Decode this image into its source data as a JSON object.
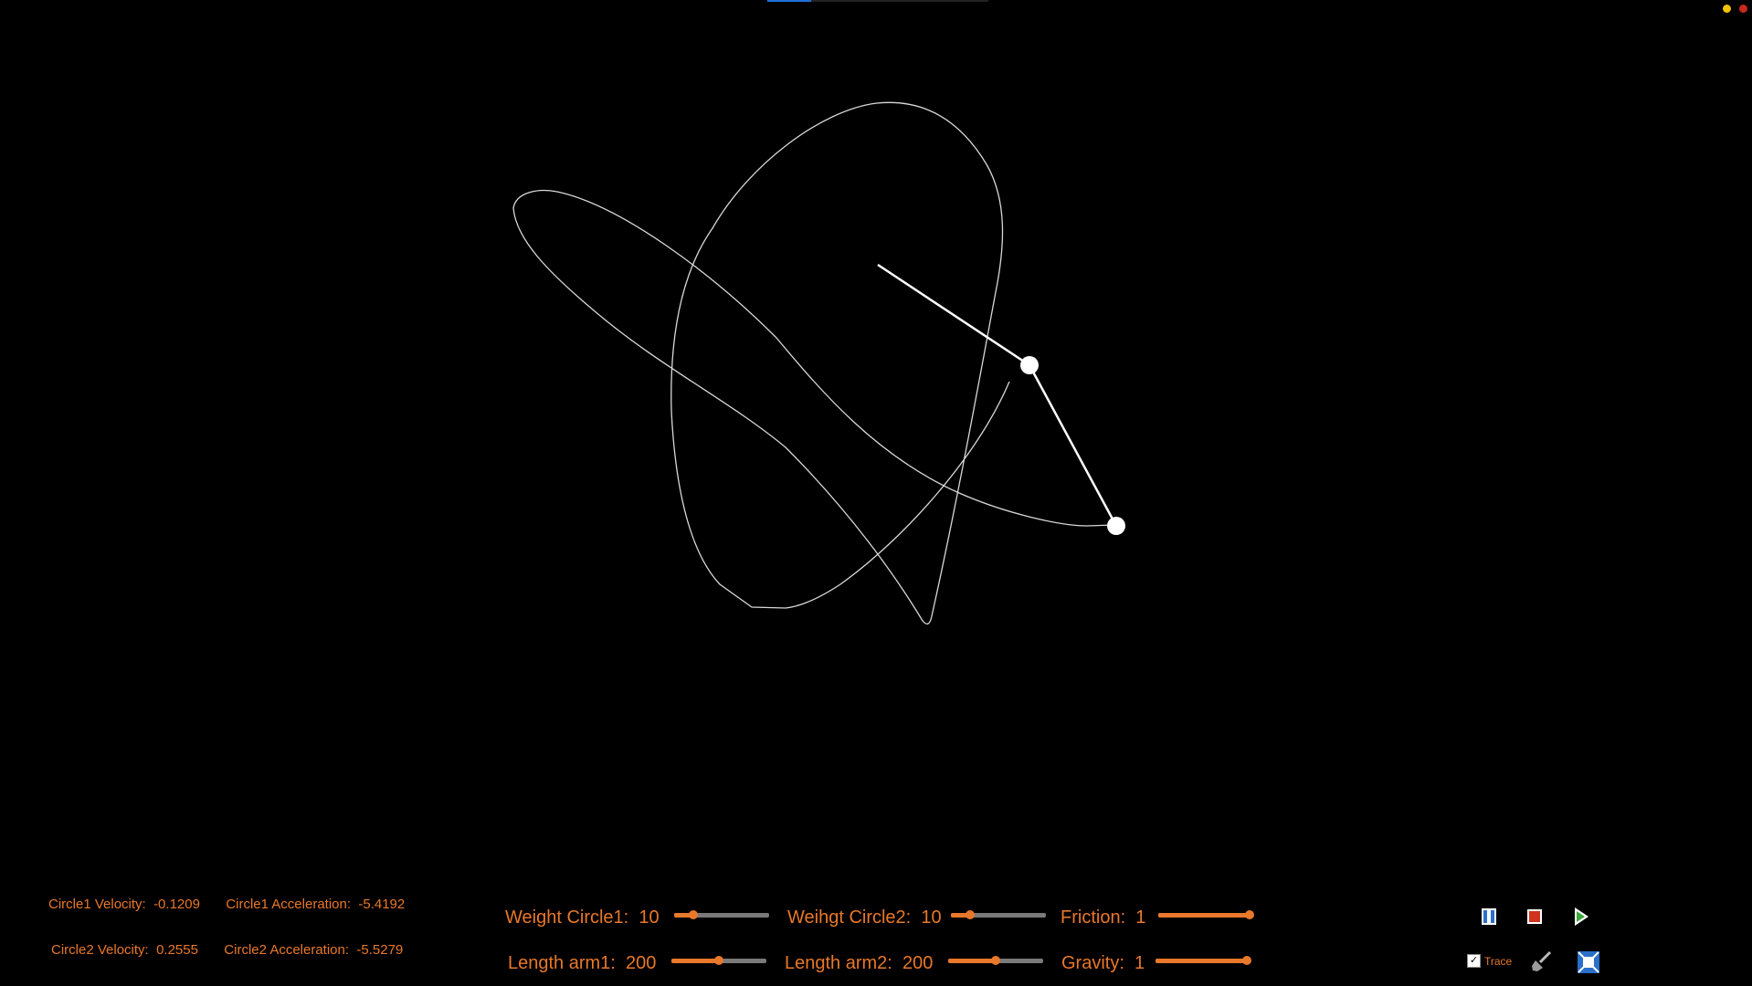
{
  "stats": {
    "c1_vel_label": "Circle1 Velocity:",
    "c1_vel_value": "-0.1209",
    "c1_acc_label": "Circle1 Acceleration:",
    "c1_acc_value": "-5.4192",
    "c2_vel_label": "Circle2 Velocity:",
    "c2_vel_value": "0.2555",
    "c2_acc_label": "Circle2 Acceleration:",
    "c2_acc_value": "-5.5279"
  },
  "controls": {
    "weight1": {
      "label": "Weight Circle1:",
      "value": "10",
      "fraction": 0.2
    },
    "weight2": {
      "label": "Weihgt Circle2:",
      "value": "10",
      "fraction": 0.2
    },
    "friction": {
      "label": "Friction:",
      "value": "1",
      "fraction": 1.0
    },
    "length1": {
      "label": "Length arm1:",
      "value": "200",
      "fraction": 0.5
    },
    "length2": {
      "label": "Length arm2:",
      "value": "200",
      "fraction": 0.5
    },
    "gravity": {
      "label": "Gravity:",
      "value": "1",
      "fraction": 1.0
    }
  },
  "toolbar": {
    "trace_label": "Trace",
    "trace_checked": true,
    "pause_icon": "pause-icon",
    "stop_icon": "stop-icon",
    "play_icon": "play-icon",
    "clear_icon": "brush-icon",
    "fit_icon": "fit-screen-icon"
  },
  "colors": {
    "accent": "#e8782a",
    "background": "#000000",
    "pendulum": "#ffffff",
    "pause": "#2a6fc9",
    "stop": "#d0321e",
    "play": "#3aa83a"
  }
}
